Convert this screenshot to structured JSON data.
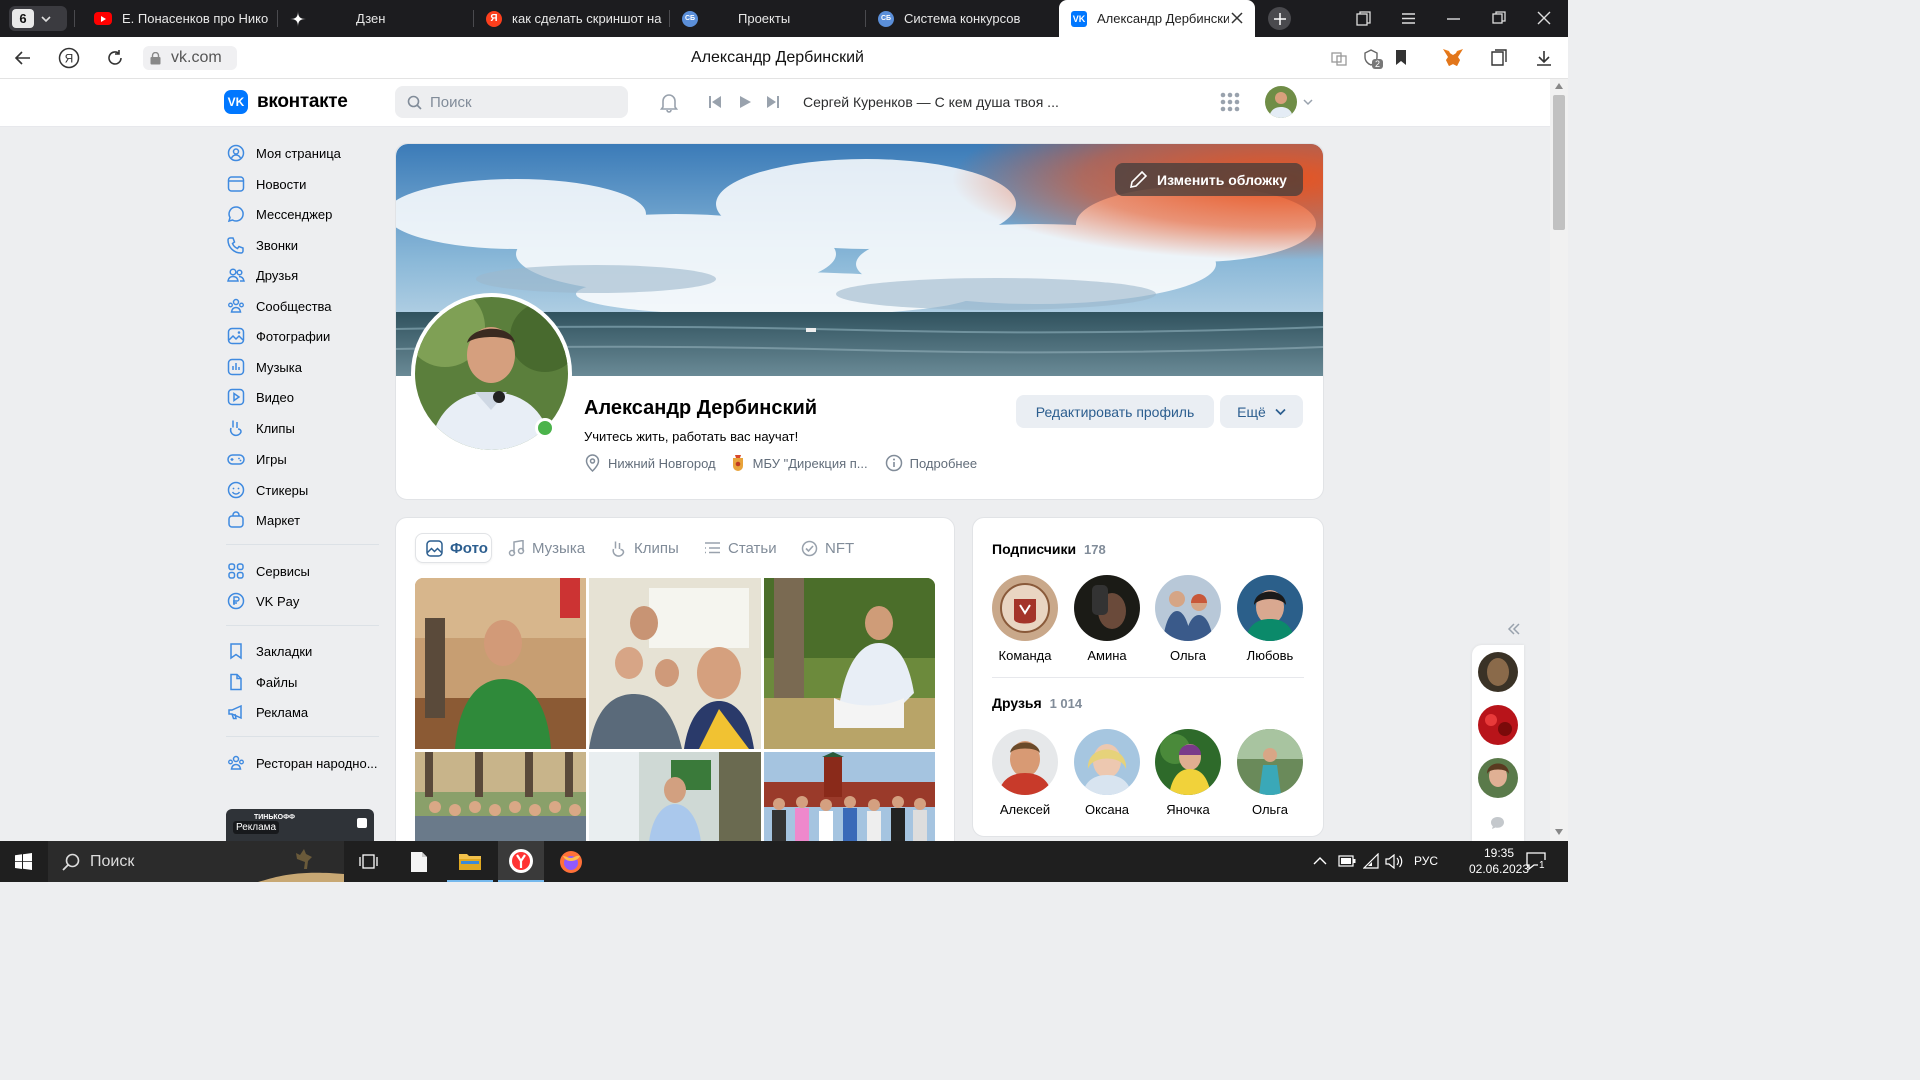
{
  "browser": {
    "tab_count": "6",
    "tabs": [
      {
        "title": "Е. Понасенков про Нико",
        "icon": "youtube-icon"
      },
      {
        "title": "Дзен",
        "icon": "dzen-icon"
      },
      {
        "title": "как сделать скриншот на",
        "icon": "yandex-icon"
      },
      {
        "title": "Проекты",
        "icon": "sb-icon"
      },
      {
        "title": "Система конкурсов",
        "icon": "sb-icon"
      },
      {
        "title": "Александр Дербински",
        "icon": "vk-icon"
      }
    ],
    "url": "vk.com",
    "page_title": "Александр Дербинский",
    "extension_badge": "2"
  },
  "vk": {
    "logo_text": "вконтакте",
    "search_placeholder": "Поиск",
    "now_playing": "Сергей Куренков — С кем душа твоя ...",
    "menu": [
      "Моя страница",
      "Новости",
      "Мессенджер",
      "Звонки",
      "Друзья",
      "Сообщества",
      "Фотографии",
      "Музыка",
      "Видео",
      "Клипы",
      "Игры",
      "Стикеры",
      "Маркет",
      "Сервисы",
      "VK Pay",
      "Закладки",
      "Файлы",
      "Реклама",
      "Ресторан народно..."
    ],
    "ad_label": "Реклама",
    "ad_brand": "ТИНЬКОФФ"
  },
  "profile": {
    "change_cover": "Изменить обложку",
    "name": "Александр Дербинский",
    "status": "Учитесь жить, работать вас научат!",
    "city": "Нижний Новгород",
    "work": "МБУ \"Дирекция п...",
    "more_info": "Подробнее",
    "edit_button": "Редактировать профиль",
    "more_button": "Ещё"
  },
  "media_tabs": [
    "Фото",
    "Музыка",
    "Клипы",
    "Статьи",
    "NFT"
  ],
  "subscribers": {
    "label": "Подписчики",
    "count": "178",
    "people": [
      "Команда",
      "Амина",
      "Ольга",
      "Любовь"
    ]
  },
  "friends": {
    "label": "Друзья",
    "count": "1 014",
    "people": [
      "Алексей",
      "Оксана",
      "Яночка",
      "Ольга"
    ]
  },
  "taskbar": {
    "search": "Поиск",
    "lang": "РУС",
    "time": "19:35",
    "date": "02.06.2023",
    "notif_count": "1"
  },
  "colors": {
    "vk_blue": "#0077ff",
    "link_blue": "#2c5e8f",
    "online_green": "#4bb34b"
  }
}
